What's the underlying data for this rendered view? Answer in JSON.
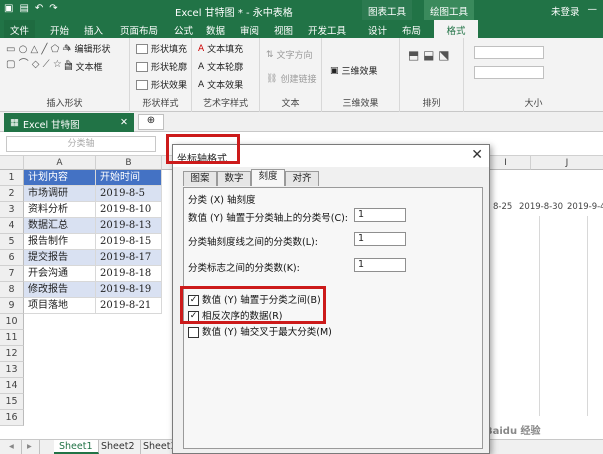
{
  "titlebar": {
    "title": "Excel 甘特图 * - 永中表格",
    "ctx1": "图表工具",
    "ctx2": "绘图工具",
    "user": "未登录"
  },
  "tabs": [
    "文件",
    "开始",
    "插入",
    "页面布局",
    "公式",
    "数据",
    "审阅",
    "视图",
    "开发工具",
    "设计",
    "布局",
    "格式"
  ],
  "ribbon": {
    "edit_shape": "编辑形状",
    "text_box": "文本框",
    "group_insert": "插入形状",
    "shape_fill": "形状填充",
    "shape_outline": "形状轮廓",
    "shape_effect": "形状效果",
    "group_style": "形状样式",
    "text_fill": "文本填充",
    "text_outline": "文本轮廓",
    "text_effect": "文本效果",
    "group_art": "艺术字样式",
    "text_dir": "文字方向",
    "create_link": "创建链接",
    "group_text": "文本",
    "effect_3d": "三维效果",
    "group_3d": "三维效果",
    "group_arrange": "排列",
    "group_size": "大小"
  },
  "doc_tab": "Excel 甘特图",
  "namebox": "分类轴",
  "columns": [
    "A",
    "B",
    "C"
  ],
  "rows": [
    "1",
    "2",
    "3",
    "4",
    "5",
    "6",
    "7",
    "8",
    "9",
    "10",
    "11",
    "12",
    "13",
    "14",
    "15",
    "16"
  ],
  "table": [
    [
      "计划内容",
      "开始时间"
    ],
    [
      "市场调研",
      "2019-8-5"
    ],
    [
      "资料分析",
      "2019-8-10"
    ],
    [
      "数据汇总",
      "2019-8-13"
    ],
    [
      "报告制作",
      "2019-8-15"
    ],
    [
      "提交报告",
      "2019-8-17"
    ],
    [
      "开会沟通",
      "2019-8-18"
    ],
    [
      "修改报告",
      "2019-8-19"
    ],
    [
      "项目落地",
      "2019-8-21"
    ]
  ],
  "chart": {
    "col_i": "I",
    "col_j": "J",
    "dates": [
      "8-25",
      "2019-8-30",
      "2019-9-4"
    ]
  },
  "sheets": [
    "Sheet1",
    "Sheet2",
    "Sheet3"
  ],
  "dialog": {
    "title": "坐标轴格式",
    "tabs": [
      "图案",
      "数字",
      "刻度",
      "对齐"
    ],
    "section": "分类 (X) 轴刻度",
    "f1_label": "数值 (Y) 轴置于分类轴上的分类号(C):",
    "f1_value": "1",
    "f2_label": "分类轴刻度线之间的分类数(L):",
    "f2_value": "1",
    "f3_label": "分类标志之间的分类数(K):",
    "f3_value": "1",
    "c1_label": "数值 (Y) 轴置于分类之间(B)",
    "c1_mark": "✓",
    "c2_label": "相反次序的数据(R)",
    "c2_mark": "✓",
    "c3_label": "数值 (Y) 轴交叉于最大分类(M)",
    "close": "✕"
  },
  "watermark": "Baidu 经验"
}
